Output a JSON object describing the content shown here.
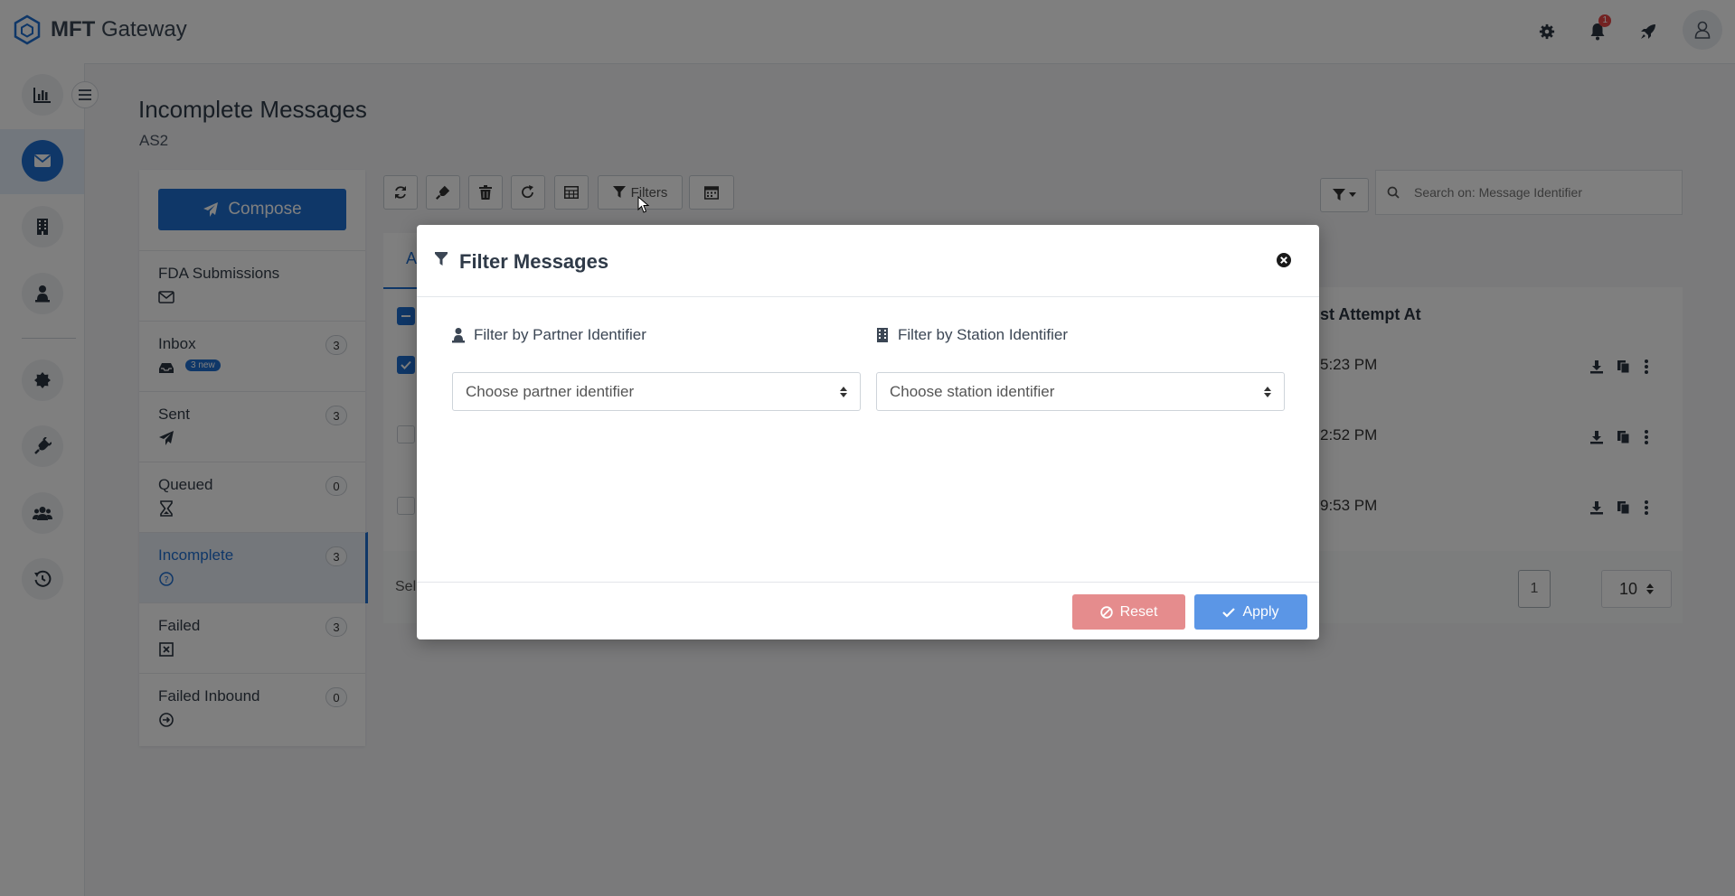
{
  "app": {
    "brand_bold": "MFT",
    "brand_rest": "Gateway",
    "notification_count": "1"
  },
  "page": {
    "title": "Incomplete Messages",
    "subtitle": "AS2"
  },
  "compose_label": "Compose",
  "folders": [
    {
      "name": "FDA Submissions",
      "count": "",
      "icon": "envelope-icon"
    },
    {
      "name": "Inbox",
      "count": "3",
      "new_tag": "3 new",
      "icon": "inbox-icon"
    },
    {
      "name": "Sent",
      "count": "3",
      "icon": "paper-plane-icon"
    },
    {
      "name": "Queued",
      "count": "0",
      "icon": "hourglass-icon"
    },
    {
      "name": "Incomplete",
      "count": "3",
      "icon": "question-circle-icon"
    },
    {
      "name": "Failed",
      "count": "3",
      "icon": "x-square-icon"
    },
    {
      "name": "Failed Inbound",
      "count": "0",
      "icon": "arrow-circle-icon"
    }
  ],
  "toolbar": {
    "filters_label": "Filters"
  },
  "search": {
    "placeholder": "Search on: Message Identifier"
  },
  "table": {
    "tab_label": "A",
    "column_last_attempt": "st Attempt At",
    "rows": [
      {
        "time": "5:23 PM"
      },
      {
        "time": "2:52 PM"
      },
      {
        "time": "9:53 PM"
      }
    ],
    "selection_text": "Sel",
    "page_number": "1",
    "page_size": "10"
  },
  "modal": {
    "title": "Filter Messages",
    "partner_label": "Filter by Partner Identifier",
    "partner_placeholder": "Choose partner identifier",
    "station_label": "Filter by Station Identifier",
    "station_placeholder": "Choose station identifier",
    "reset_label": "Reset",
    "apply_label": "Apply"
  },
  "colors": {
    "primary": "#1f6fd1",
    "reset": "#e58c8d",
    "apply": "#5b96e6"
  }
}
